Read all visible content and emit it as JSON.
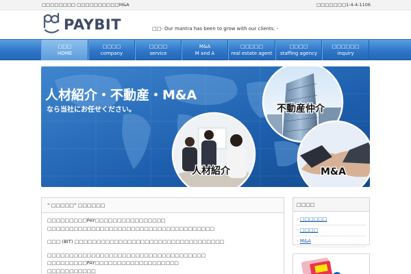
{
  "topbar": {
    "left_text": "□□□□□□□□ □□□□□□□□□□M&A",
    "right_text": "□□□□□□□1-4-4-1106"
  },
  "header": {
    "logo_text": "PAYBIT",
    "tagline": "□□- Our mantra has been to grow with our clients. -"
  },
  "nav": {
    "items": [
      {
        "jp": "□□□",
        "en": "HOME",
        "active": true
      },
      {
        "jp": "□□□□",
        "en": "company",
        "active": false
      },
      {
        "jp": "□□□□",
        "en": "service",
        "active": false
      },
      {
        "jp": "M&A",
        "en": "M and A",
        "active": false
      },
      {
        "jp": "□□□□□",
        "en": "real estate agent",
        "active": false
      },
      {
        "jp": "□□□□",
        "en": "staffing agency",
        "active": false
      },
      {
        "jp": "□□□□□□",
        "en": "inquiry",
        "active": false
      }
    ]
  },
  "banner": {
    "headline": "人材紹介・不動産・M&A",
    "subline": "なら当社にお任せください。",
    "label_realestate": "不動産仲介",
    "label_staffing": "人材紹介",
    "label_ma": "M&A"
  },
  "main": {
    "title": "“ □□□□□” □□□□□□",
    "paragraphs": [
      [
        "□□□□□□□□□PAY□□□□□□□□□□□□□□□□",
        "□□□□□□□□□□□□□□□□□□□□□□□□□□□□□□□□□□□□□□"
      ],
      [
        "□□□ (BIT) □□□□□□□□□□□□□□□□□□□□□□□□□□□□□□□□□□"
      ],
      [
        "□□□□□□□□□□□□□□□□□□□□□□□□□□□□□□□□□□□□",
        "□□□□□□□□□PAY□□□□□□□□□□□□□□□□□□□",
        "□□□□□□□□□□□"
      ]
    ]
  },
  "sidebar": {
    "title": "□□□□",
    "links": [
      "□□□□□□",
      "□□□□",
      "M&A"
    ]
  },
  "colors": {
    "nav_blue": "#2f77c9",
    "link_blue": "#1a5fb4",
    "banner_blue": "#1d5fae"
  }
}
